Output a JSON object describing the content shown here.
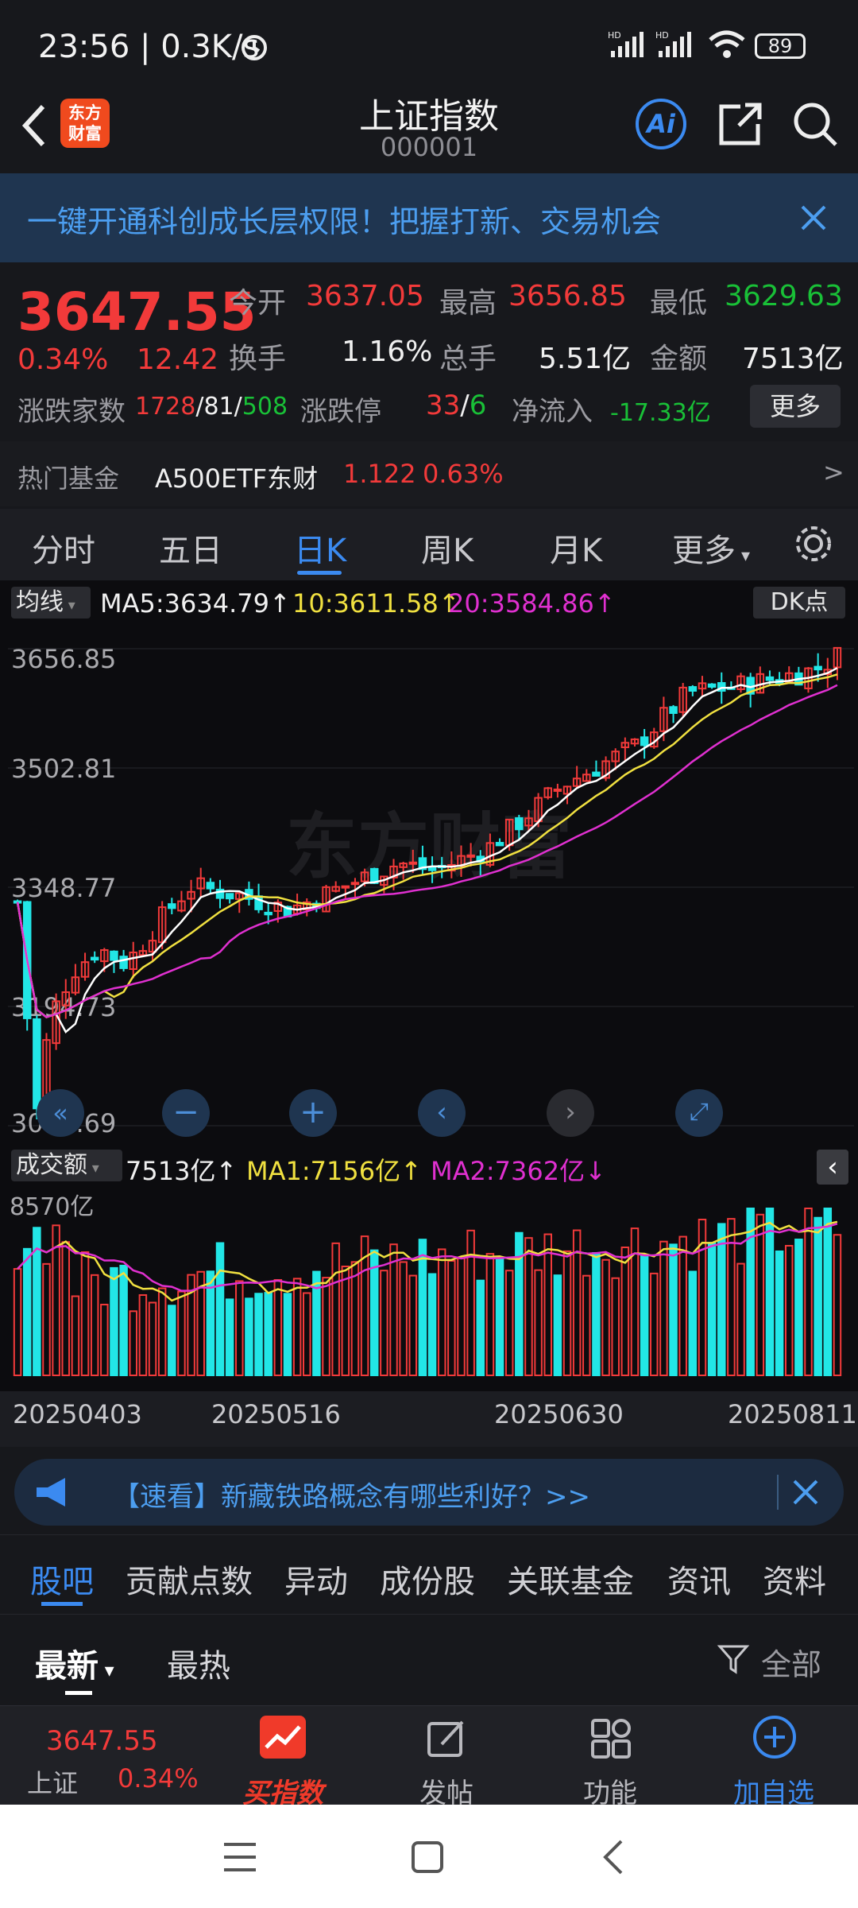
{
  "status_bar": {
    "time": "23:56",
    "speed": "0.3K/s",
    "battery": "89"
  },
  "header": {
    "title": "上证指数",
    "code": "000001",
    "logo_text_1": "东方",
    "logo_text_2": "财富",
    "ai_label": "Ai"
  },
  "banner": {
    "text": "一键开通科创成长层权限！把握打新、交易机会"
  },
  "quote": {
    "price": "3647.55",
    "change_pct": "0.34%",
    "change": "12.42",
    "open_label": "今开",
    "open": "3637.05",
    "high_label": "最高",
    "high": "3656.85",
    "low_label": "最低",
    "low": "3629.63",
    "turnover_label": "换手",
    "turnover": "1.16%",
    "volume_label": "总手",
    "volume": "5.51亿",
    "amount_label": "金额",
    "amount": "7513亿",
    "adv_label": "涨跌家数",
    "adv_up": "1728",
    "adv_flat": "81",
    "adv_down": "508",
    "limit_label": "涨跌停",
    "limit_up": "33",
    "limit_down": "6",
    "inflow_label": "净流入",
    "inflow": "-17.33亿",
    "more_button": "更多"
  },
  "hot_fund": {
    "label": "热门基金",
    "name": "A500ETF东财",
    "price": "1.122",
    "pct": "0.63%",
    "arrow": ">"
  },
  "chart_tabs": [
    "分时",
    "五日",
    "日K",
    "周K",
    "月K",
    "更多"
  ],
  "chart_tabs_active": 2,
  "main_chart": {
    "indicator_select": "均线",
    "ma5": "MA5:3634.79↑",
    "ma10": "10:3611.58↑",
    "ma20": "20:3584.86↑",
    "dk_button": "DK点",
    "price_labels": [
      "3656.85",
      "3502.81",
      "3348.77",
      "3194.73",
      "3040.69"
    ],
    "watermark": "东方财富"
  },
  "volume_chart": {
    "indicator_select": "成交额",
    "value": "7513亿↑",
    "ma1": "MA1:7156亿↑",
    "ma2": "MA2:7362亿↓",
    "max_label": "8570亿",
    "dates": [
      "20250403",
      "20250516",
      "20250630",
      "20250811"
    ]
  },
  "chart_data": {
    "type": "candlestick",
    "x_labels": [
      "20250403",
      "20250516",
      "20250630",
      "20250811"
    ],
    "y_ticks": [
      3656.85,
      3502.81,
      3348.77,
      3194.73,
      3040.69
    ],
    "ylim": [
      3040.69,
      3656.85
    ],
    "latest": {
      "close": 3647.55,
      "open": 3637.05,
      "high": 3656.85,
      "low": 3629.63
    },
    "ma": {
      "MA5": 3634.79,
      "MA10": 3611.58,
      "MA20": 3584.86
    },
    "volume": {
      "latest": "7513亿",
      "MA1": "7156亿",
      "MA2": "7362亿",
      "max": "8570亿"
    },
    "colors": {
      "up": "#f23a3a",
      "down": "#22e6e6",
      "ma5": "#ffffff",
      "ma10": "#f0e040",
      "ma20": "#e030d0"
    }
  },
  "news": {
    "text": "【速看】新藏铁路概念有哪些利好？>>"
  },
  "bottom_tabs": [
    "股吧",
    "贡献点数",
    "异动",
    "成份股",
    "关联基金",
    "资讯",
    "资料"
  ],
  "bottom_tabs_active": 0,
  "sort": {
    "latest": "最新",
    "hot": "最热",
    "filter": "全部"
  },
  "toolbar": {
    "index_price": "3647.55",
    "index_name": "上证",
    "index_pct": "0.34%",
    "buy_index": "买指数",
    "post": "发帖",
    "functions": "功能",
    "add_watch": "加自选"
  }
}
